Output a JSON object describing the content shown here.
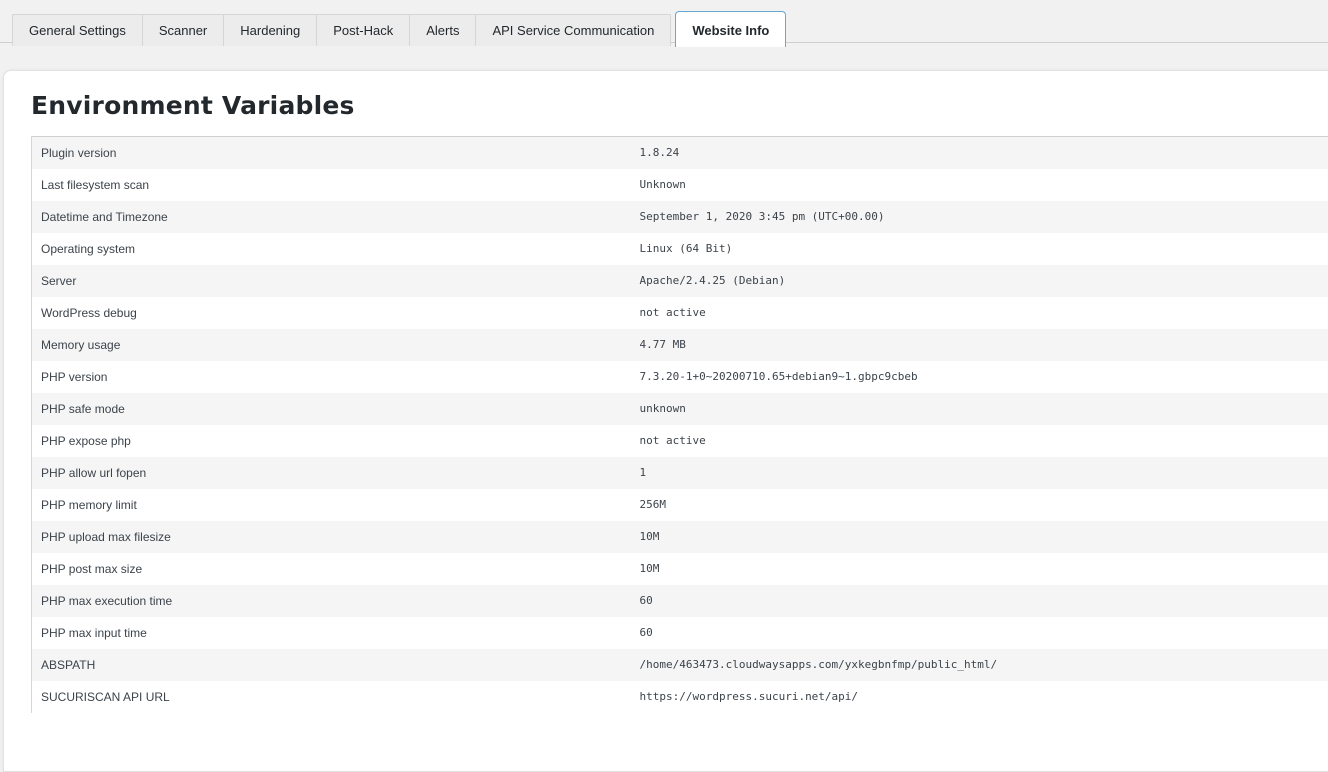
{
  "tabs": [
    {
      "label": "General Settings",
      "active": false
    },
    {
      "label": "Scanner",
      "active": false
    },
    {
      "label": "Hardening",
      "active": false
    },
    {
      "label": "Post-Hack",
      "active": false
    },
    {
      "label": "Alerts",
      "active": false
    },
    {
      "label": "API Service Communication",
      "active": false
    },
    {
      "label": "Website Info",
      "active": true
    }
  ],
  "section": {
    "title": "Environment Variables"
  },
  "env": [
    {
      "key": "Plugin version",
      "value": "1.8.24"
    },
    {
      "key": "Last filesystem scan",
      "value": "Unknown"
    },
    {
      "key": "Datetime and Timezone",
      "value": "September 1, 2020 3:45 pm (UTC+00.00)"
    },
    {
      "key": "Operating system",
      "value": "Linux (64 Bit)"
    },
    {
      "key": "Server",
      "value": "Apache/2.4.25 (Debian)"
    },
    {
      "key": "WordPress debug",
      "value": "not active"
    },
    {
      "key": "Memory usage",
      "value": "4.77 MB"
    },
    {
      "key": "PHP version",
      "value": "7.3.20-1+0~20200710.65+debian9~1.gbpc9cbeb"
    },
    {
      "key": "PHP safe mode",
      "value": "unknown"
    },
    {
      "key": "PHP expose php",
      "value": "not active"
    },
    {
      "key": "PHP allow url fopen",
      "value": "1"
    },
    {
      "key": "PHP memory limit",
      "value": "256M"
    },
    {
      "key": "PHP upload max filesize",
      "value": "10M"
    },
    {
      "key": "PHP post max size",
      "value": "10M"
    },
    {
      "key": "PHP max execution time",
      "value": "60"
    },
    {
      "key": "PHP max input time",
      "value": "60"
    },
    {
      "key": "ABSPATH",
      "value": "/home/463473.cloudwaysapps.com/yxkegbnfmp/public_html/"
    },
    {
      "key": "SUCURISCAN API URL",
      "value": "https://wordpress.sucuri.net/api/"
    }
  ],
  "colors": {
    "active_tab_border": "#6aa6d2",
    "page_background": "#f1f1f1",
    "row_alt": "#f5f5f5"
  }
}
